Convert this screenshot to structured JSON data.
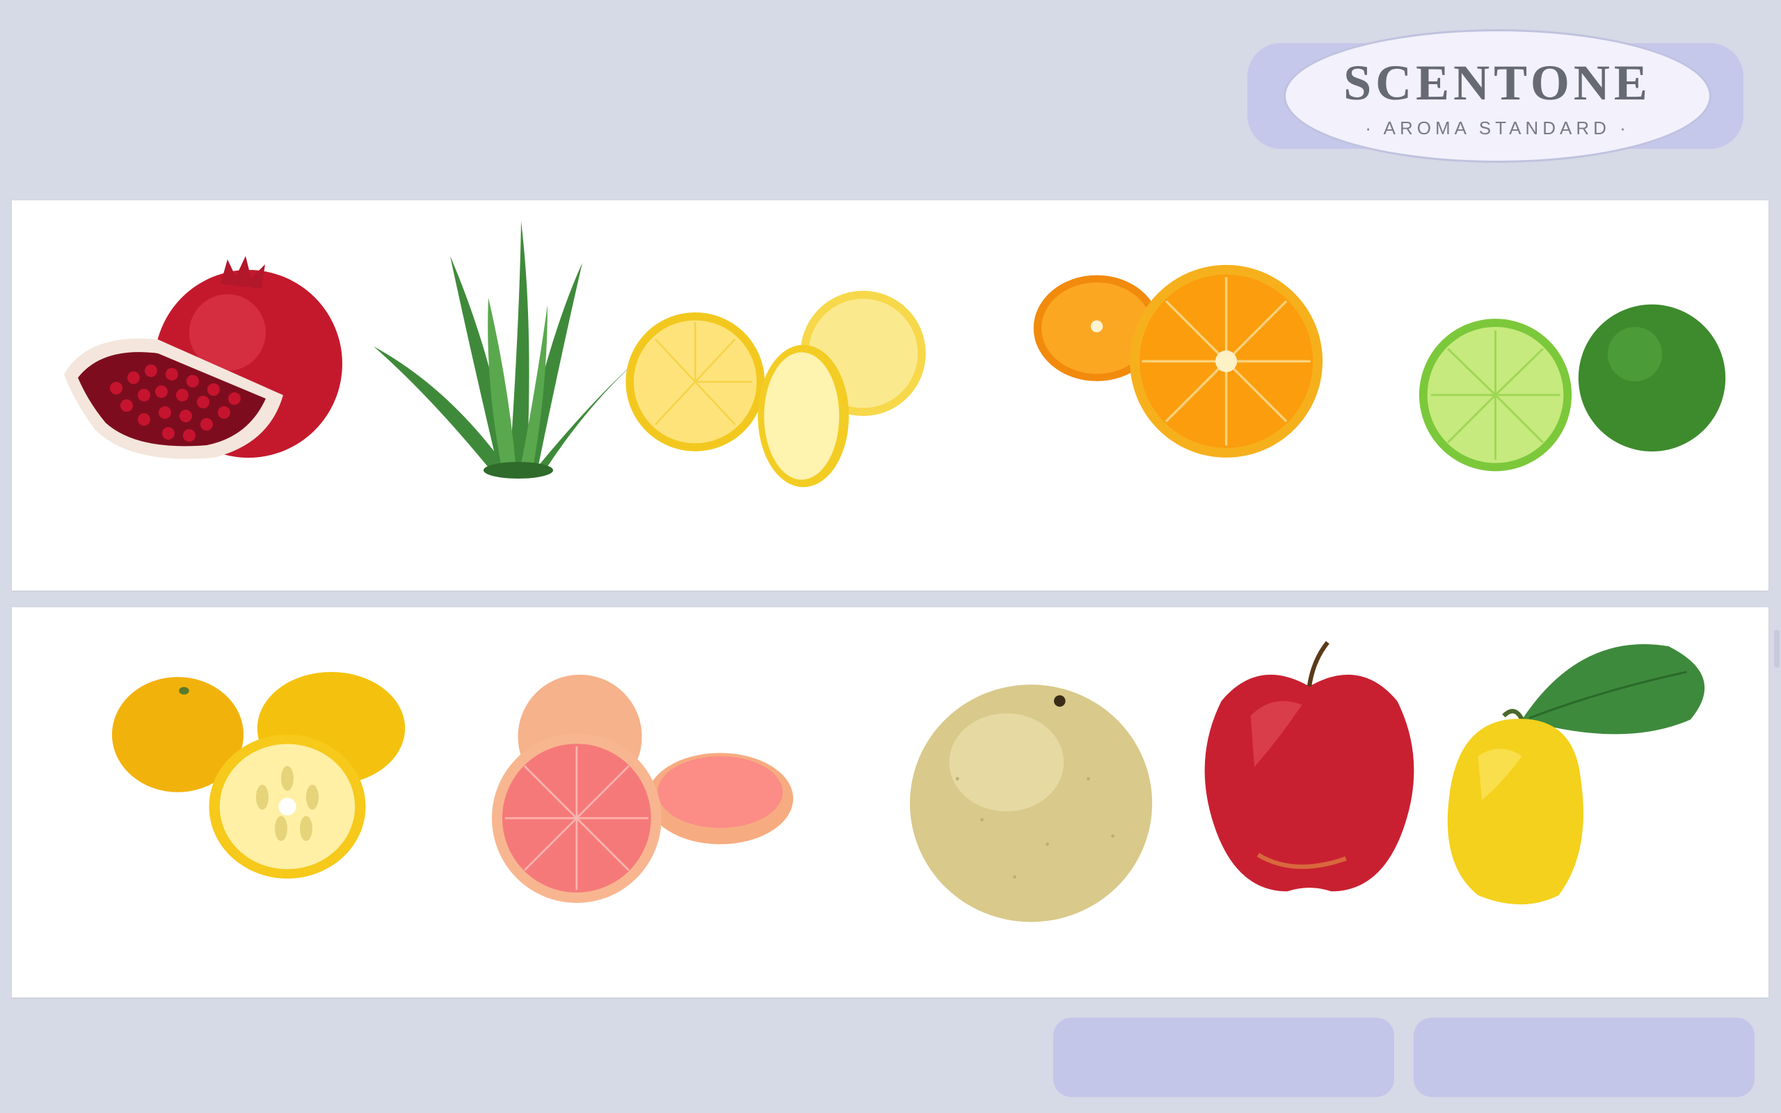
{
  "brand": {
    "name": "SCENTONE",
    "tagline": "· AROMA STANDARD ·"
  },
  "rows": [
    {
      "items": [
        {
          "icon": "pomegranate-icon",
          "label": ""
        },
        {
          "icon": "aloe-icon",
          "label": ""
        },
        {
          "icon": "lemon-icon",
          "label": ""
        },
        {
          "icon": "orange-icon",
          "label": ""
        },
        {
          "icon": "lime-icon",
          "label": ""
        }
      ]
    },
    {
      "items": [
        {
          "icon": "yuzu-icon",
          "label": ""
        },
        {
          "icon": "grapefruit-icon",
          "label": ""
        },
        {
          "icon": "pear-icon",
          "label": ""
        },
        {
          "icon": "apple-icon",
          "label": ""
        },
        {
          "icon": "quince-icon",
          "label": ""
        }
      ]
    }
  ],
  "buttons": {
    "left_label": "",
    "right_label": ""
  },
  "colors": {
    "background": "#d6d9e6",
    "accent": "#c3c6e8",
    "panel": "#ffffff",
    "logo_text": "#666a75"
  }
}
